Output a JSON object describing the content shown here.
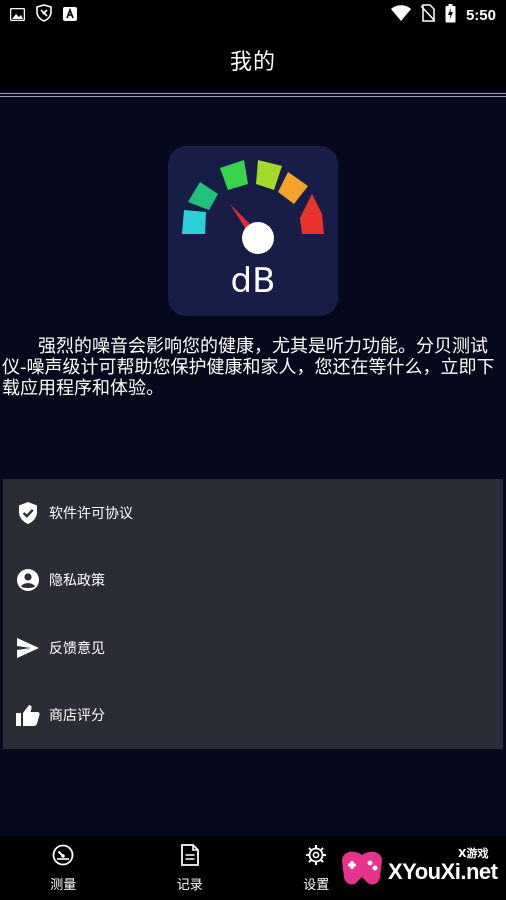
{
  "statusbar": {
    "time": "5:50",
    "icons": [
      "image-icon",
      "shield-icon",
      "a-icon",
      "wifi-icon",
      "no-sim-icon",
      "battery-charging-icon"
    ]
  },
  "appbar": {
    "title": "我的"
  },
  "logo": {
    "text": "dB",
    "icon": "decibel-gauge-icon"
  },
  "description": "强烈的噪音会影响您的健康，尤其是听力功能。分贝测试仪-噪声级计可帮助您保护健康和家人，您还在等什么，立即下载应用程序和体验。",
  "menu": {
    "items": [
      {
        "label": "软件许可协议",
        "icon": "verified-shield-icon"
      },
      {
        "label": "隐私政策",
        "icon": "account-circle-icon"
      },
      {
        "label": "反馈意见",
        "icon": "send-icon"
      },
      {
        "label": "商店评分",
        "icon": "thumb-up-icon"
      }
    ]
  },
  "bottom_nav": {
    "items": [
      {
        "label": "测量",
        "icon": "speedometer-icon"
      },
      {
        "label": "记录",
        "icon": "document-icon"
      },
      {
        "label": "设置",
        "icon": "gear-icon"
      }
    ]
  },
  "watermark": {
    "text": "XYouXi.net",
    "tag": "X游戏"
  },
  "colors": {
    "background": "#06091c",
    "bars": "#000000",
    "menu_card": "#2b2d36",
    "logo_bg": "#171d47"
  }
}
